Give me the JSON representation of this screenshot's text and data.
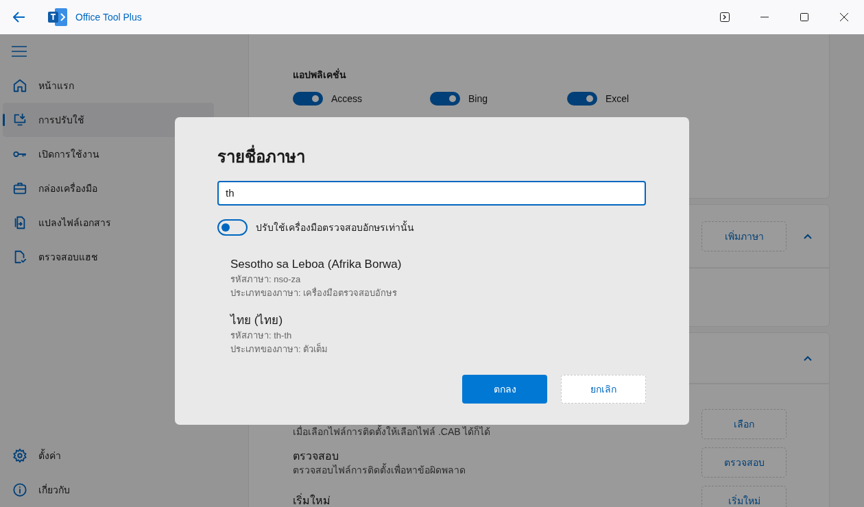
{
  "window": {
    "title": "Office Tool Plus"
  },
  "sidebar": {
    "items": [
      {
        "label": "หน้าแรก",
        "selected": false
      },
      {
        "label": "การปรับใช้",
        "selected": true
      },
      {
        "label": "เปิดการใช้งาน",
        "selected": false
      },
      {
        "label": "กล่องเครื่องมือ",
        "selected": false
      },
      {
        "label": "แปลงไฟล์เอกสาร",
        "selected": false
      },
      {
        "label": "ตรวจสอบแฮช",
        "selected": false
      }
    ],
    "footer_items": [
      {
        "label": "ตั้งค่า",
        "selected": false
      },
      {
        "label": "เกี่ยวกับ",
        "selected": false
      }
    ]
  },
  "applications": {
    "heading": "แอปพลิเคชั่น",
    "apps": [
      {
        "name": "Access",
        "on": true
      },
      {
        "name": "Bing",
        "on": true
      },
      {
        "name": "Excel",
        "on": true
      }
    ]
  },
  "language_card": {
    "button": "เพิ่มภาษา",
    "expanded": true
  },
  "actions_card": {
    "expanded": true,
    "rows": [
      {
        "description": "เมื่อเลือกไฟล์การติดตั้งให้เลือกไฟล์ .CAB ได้ก็ได้",
        "button": "เลือก"
      },
      {
        "title": "ตรวจสอบ",
        "description": "ตรวจสอบไฟล์การติดตั้งเพื่อหาข้อผิดพลาด",
        "button": "ตรวจสอบ"
      },
      {
        "title": "เริ่มใหม่",
        "button": "เริ่มใหม่"
      }
    ]
  },
  "dialog": {
    "title": "รายชื่อภาษา",
    "search": {
      "value": "th"
    },
    "filter_toggle": {
      "label": "ปรับใช้เครื่องมือตรวจสอบอักษรเท่านั้น",
      "on": false
    },
    "results": [
      {
        "name": "Sesotho sa Leboa (Afrika Borwa)",
        "code": "รหัสภาษา: nso-za",
        "type": "ประเภทของภาษา: เครื่องมือตรวจสอบอักษร"
      },
      {
        "name": "ไทย (ไทย)",
        "code": "รหัสภาษา: th-th",
        "type": "ประเภทของภาษา: ตัวเต็ม"
      }
    ],
    "buttons": [
      {
        "label": "ตกลง",
        "kind": "primary"
      },
      {
        "label": "ยกเลิก",
        "kind": "secondary"
      }
    ]
  }
}
